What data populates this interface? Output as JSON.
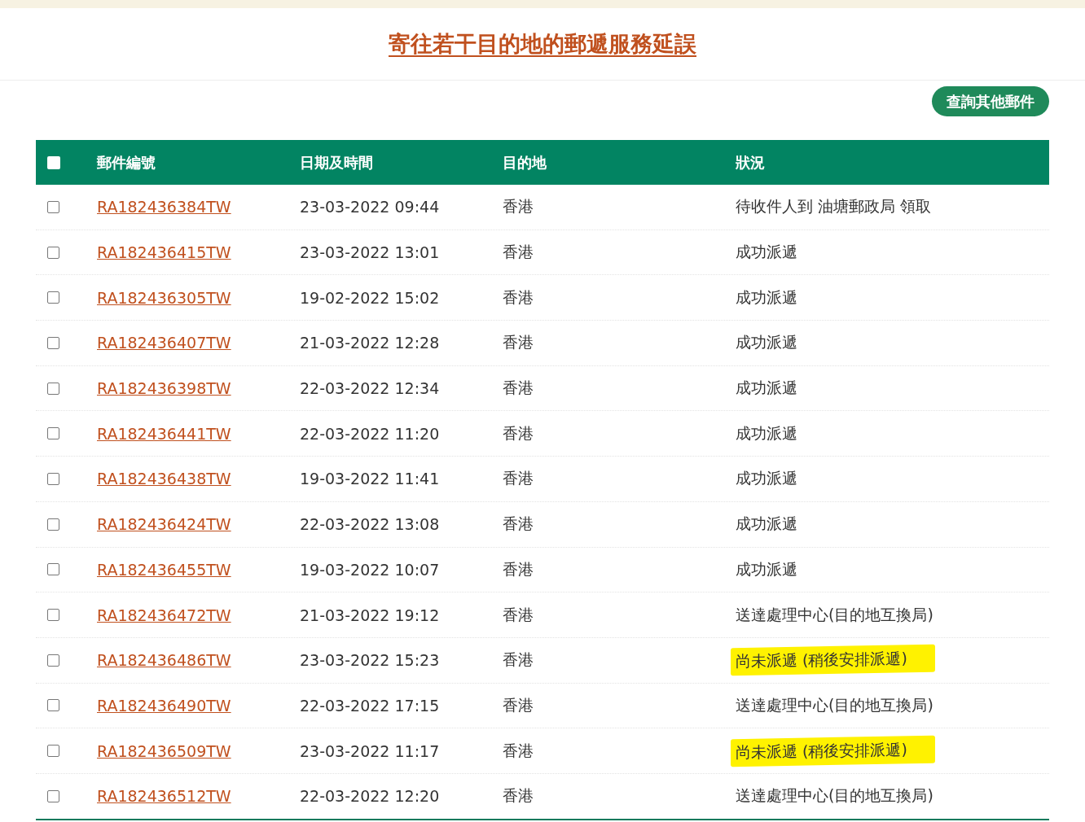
{
  "title": "寄往若干目的地的郵遞服務延誤",
  "query_button": "查詢其他郵件",
  "table": {
    "select_all": {
      "checked": false
    },
    "columns": [
      "郵件編號",
      "日期及時間",
      "目的地",
      "狀況"
    ],
    "rows": [
      {
        "checked": false,
        "number": "RA182436384TW",
        "datetime": "23-03-2022 09:44",
        "destination": "香港",
        "status": "待收件人到 油塘郵政局 領取",
        "highlighted": false
      },
      {
        "checked": false,
        "number": "RA182436415TW",
        "datetime": "23-03-2022 13:01",
        "destination": "香港",
        "status": "成功派遞",
        "highlighted": false
      },
      {
        "checked": false,
        "number": "RA182436305TW",
        "datetime": "19-02-2022 15:02",
        "destination": "香港",
        "status": "成功派遞",
        "highlighted": false
      },
      {
        "checked": false,
        "number": "RA182436407TW",
        "datetime": "21-03-2022 12:28",
        "destination": "香港",
        "status": "成功派遞",
        "highlighted": false
      },
      {
        "checked": false,
        "number": "RA182436398TW",
        "datetime": "22-03-2022 12:34",
        "destination": "香港",
        "status": "成功派遞",
        "highlighted": false
      },
      {
        "checked": false,
        "number": "RA182436441TW",
        "datetime": "22-03-2022 11:20",
        "destination": "香港",
        "status": "成功派遞",
        "highlighted": false
      },
      {
        "checked": false,
        "number": "RA182436438TW",
        "datetime": "19-03-2022 11:41",
        "destination": "香港",
        "status": "成功派遞",
        "highlighted": false
      },
      {
        "checked": false,
        "number": "RA182436424TW",
        "datetime": "22-03-2022 13:08",
        "destination": "香港",
        "status": "成功派遞",
        "highlighted": false
      },
      {
        "checked": false,
        "number": "RA182436455TW",
        "datetime": "19-03-2022 10:07",
        "destination": "香港",
        "status": "成功派遞",
        "highlighted": false
      },
      {
        "checked": false,
        "number": "RA182436472TW",
        "datetime": "21-03-2022 19:12",
        "destination": "香港",
        "status": "送達處理中心(目的地互換局)",
        "highlighted": false
      },
      {
        "checked": false,
        "number": "RA182436486TW",
        "datetime": "23-03-2022 15:23",
        "destination": "香港",
        "status": "尚未派遞 (稍後安排派遞)",
        "highlighted": true
      },
      {
        "checked": false,
        "number": "RA182436490TW",
        "datetime": "22-03-2022 17:15",
        "destination": "香港",
        "status": "送達處理中心(目的地互換局)",
        "highlighted": false
      },
      {
        "checked": false,
        "number": "RA182436509TW",
        "datetime": "23-03-2022 11:17",
        "destination": "香港",
        "status": "尚未派遞 (稍後安排派遞)",
        "highlighted": true
      },
      {
        "checked": false,
        "number": "RA182436512TW",
        "datetime": "22-03-2022 12:20",
        "destination": "香港",
        "status": "送達處理中心(目的地互換局)",
        "highlighted": false
      }
    ]
  }
}
